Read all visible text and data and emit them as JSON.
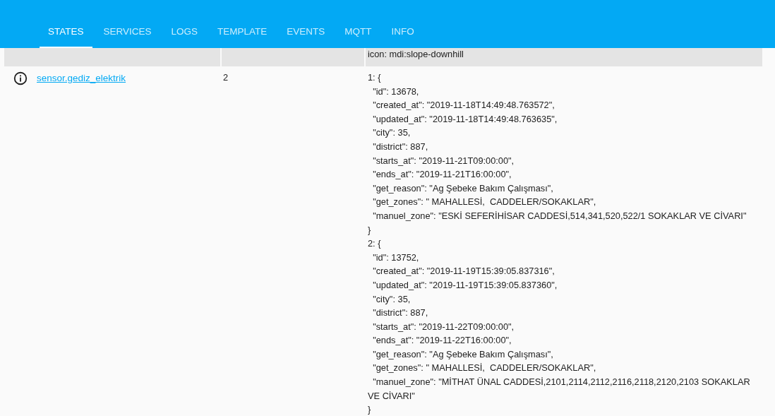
{
  "tabs": [
    {
      "label": "STATES",
      "selected": true
    },
    {
      "label": "SERVICES",
      "selected": false
    },
    {
      "label": "LOGS",
      "selected": false
    },
    {
      "label": "TEMPLATE",
      "selected": false
    },
    {
      "label": "EVENTS",
      "selected": false
    },
    {
      "label": "MQTT",
      "selected": false
    },
    {
      "label": "INFO",
      "selected": false
    }
  ],
  "table": {
    "rows": [
      {
        "entity": "",
        "state": "",
        "attributes": [
          "icon: mdi:slope-downhill"
        ],
        "highlighted": true
      },
      {
        "entity": "sensor.gediz_elektrik",
        "state": "2",
        "highlighted": false,
        "attributes": [
          "1: {",
          "  \"id\": 13678,",
          "  \"created_at\": \"2019-11-18T14:49:48.763572\",",
          "  \"updated_at\": \"2019-11-18T14:49:48.763635\",",
          "  \"city\": 35,",
          "  \"district\": 887,",
          "  \"starts_at\": \"2019-11-21T09:00:00\",",
          "  \"ends_at\": \"2019-11-21T16:00:00\",",
          "  \"get_reason\": \"Ag Şebeke Bakım Çalışması\",",
          "  \"get_zones\": \" MAHALLESİ,  CADDELER/SOKAKLAR\",",
          "  \"manuel_zone\": \"ESKİ SEFERİHİSAR CADDESİ,514,341,520,522/1 SOKAKLAR VE CİVARI\"",
          "}",
          "2: {",
          "  \"id\": 13752,",
          "  \"created_at\": \"2019-11-19T15:39:05.837316\",",
          "  \"updated_at\": \"2019-11-19T15:39:05.837360\",",
          "  \"city\": 35,",
          "  \"district\": 887,",
          "  \"starts_at\": \"2019-11-22T09:00:00\",",
          "  \"ends_at\": \"2019-11-22T16:00:00\",",
          "  \"get_reason\": \"Ag Şebeke Bakım Çalışması\",",
          "  \"get_zones\": \" MAHALLESİ,  CADDELER/SOKAKLAR\",",
          "  \"manuel_zone\": \"MİTHAT ÜNAL CADDESİ,2101,2114,2112,2116,2118,2120,2103 SOKAKLAR VE CİVARI\"",
          "}"
        ]
      }
    ]
  }
}
